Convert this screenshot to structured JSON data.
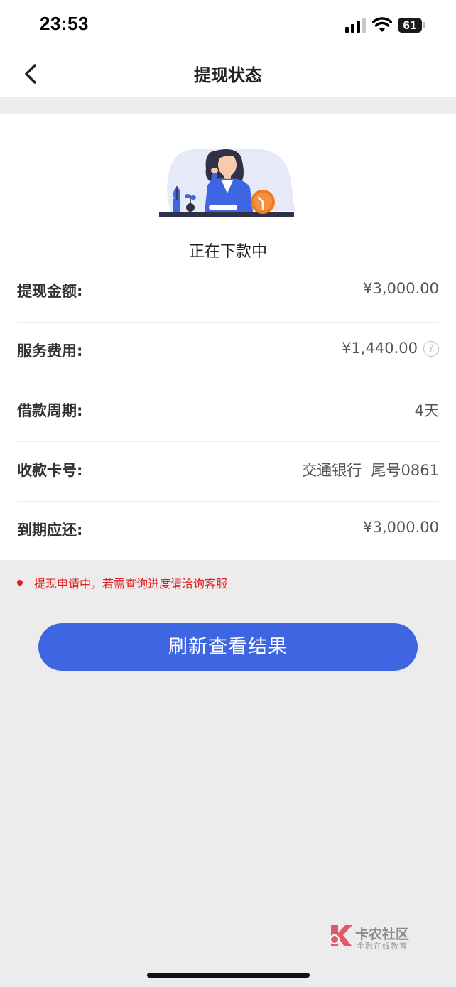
{
  "status_bar": {
    "time": "23:53",
    "battery": "61"
  },
  "nav": {
    "title": "提现状态",
    "back_icon": "chevron-left-icon"
  },
  "status": {
    "text": "正在下款中"
  },
  "details": {
    "rows": [
      {
        "label": "提现金额:",
        "value": "¥3,000.00"
      },
      {
        "label": "服务费用:",
        "value": "¥1,440.00",
        "help_icon": "question-circle-icon"
      },
      {
        "label": "借款周期:",
        "value": "4天"
      },
      {
        "label": "收款卡号:",
        "value": "交通银行  尾号0861"
      },
      {
        "label": "到期应还:",
        "value": "¥3,000.00"
      }
    ]
  },
  "notice": "提现申请中，若需查询进度请洽询客服",
  "refresh_button": "刷新查看结果",
  "watermark": {
    "title": "卡农社区",
    "subtitle": "金融在线教育"
  },
  "colors": {
    "accent": "#3f66e2",
    "notice_red": "#e02020",
    "background": "#ececec",
    "clock_orange": "#f07a1e"
  }
}
